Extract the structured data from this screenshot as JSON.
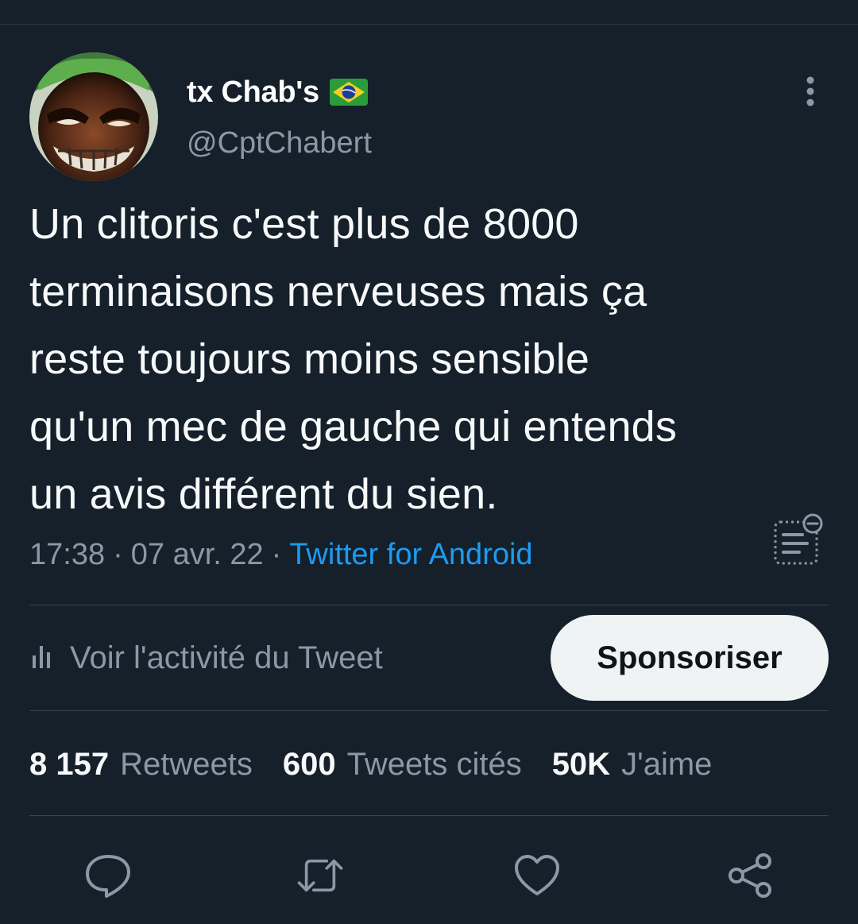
{
  "author": {
    "display_name": "tx Chab's",
    "handle": "@CptChabert",
    "flag": "flag-brazil-icon"
  },
  "tweet": {
    "text": "Un clitoris c'est plus de 8000\nterminaisons nerveuses mais ça\nreste toujours moins sensible\nqu'un mec de gauche qui entends\nun avis différent du sien.",
    "time": "17:38",
    "separator": "·",
    "date": "07 avr. 22",
    "source": "Twitter for Android"
  },
  "activity": {
    "label": "Voir l'activité du Tweet",
    "icon": "bar-chart-icon"
  },
  "sponsor_button": {
    "label": "Sponsoriser"
  },
  "stats": {
    "retweets": {
      "value": "8 157",
      "label": "Retweets"
    },
    "quotes": {
      "value": "600",
      "label": "Tweets cités"
    },
    "likes": {
      "value": "50K",
      "label": "J'aime"
    }
  },
  "actions": [
    "reply-icon",
    "retweet-icon",
    "like-icon",
    "share-icon"
  ],
  "colors": {
    "background": "#15202b",
    "text": "#f7f9f9",
    "muted": "#8b98a5",
    "link": "#1d9bf0",
    "divider": "#38444d",
    "button_bg": "#eff3f4"
  }
}
